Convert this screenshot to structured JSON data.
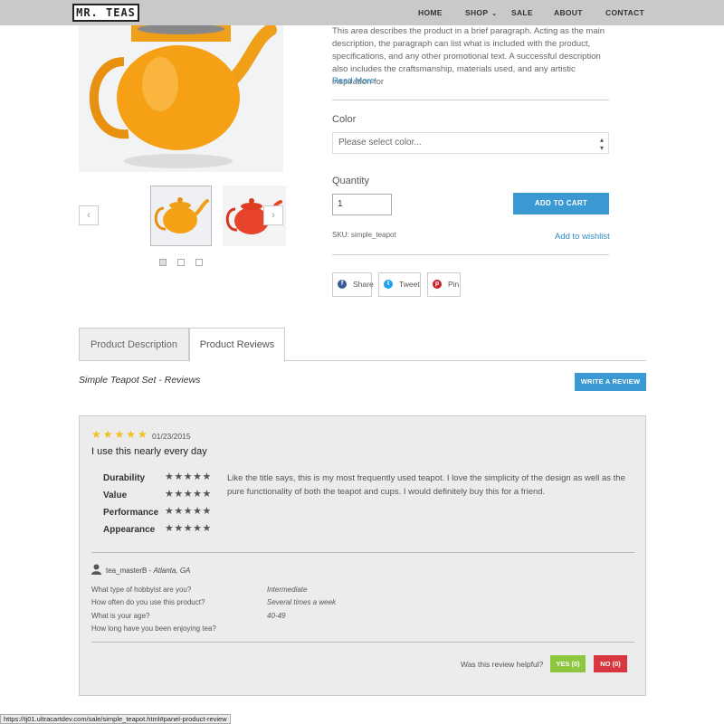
{
  "header": {
    "logo": "MR. TEAS",
    "nav": [
      {
        "label": "HOME"
      },
      {
        "label": "SHOP"
      },
      {
        "label": "SALE"
      },
      {
        "label": "ABOUT"
      },
      {
        "label": "CONTACT"
      }
    ]
  },
  "product": {
    "description": "This area describes the product in a brief paragraph. Acting as the main description, the paragraph can list what is included with the product, specifications, and any other promotional text. A successful description also includes the craftsmanship, materials used, and any artistic inspiration for",
    "read_more": "Read More",
    "color_label": "Color",
    "color_placeholder": "Please select color...",
    "quantity_label": "Quantity",
    "quantity_value": "1",
    "add_to_cart": "ADD TO CART",
    "sku": "SKU: simple_teapot",
    "wishlist": "Add to wishlist",
    "share": [
      {
        "label": "Share",
        "icon": "facebook-icon",
        "color": "#3b5998"
      },
      {
        "label": "Tweet",
        "icon": "twitter-icon",
        "color": "#1da1f2"
      },
      {
        "label": "Pin",
        "icon": "pinterest-icon",
        "color": "#cb2027"
      }
    ],
    "gallery_arrows": {
      "prev": "‹",
      "next": "›"
    },
    "image_colors": {
      "orange": "#f5a015",
      "red": "#e8442a"
    }
  },
  "tabs": [
    {
      "label": "Product Description",
      "active": false
    },
    {
      "label": "Product Reviews",
      "active": true
    }
  ],
  "reviews": {
    "title": "Simple Teapot Set - Reviews",
    "write_button": "WRITE A REVIEW",
    "items": [
      {
        "stars": "★★★★★",
        "date": "01/23/2015",
        "headline": "I use this nearly every day",
        "ratings": [
          {
            "label": "Durability",
            "stars": "★★★★★"
          },
          {
            "label": "Value",
            "stars": "★★★★★"
          },
          {
            "label": "Performance",
            "stars": "★★★★★"
          },
          {
            "label": "Appearance",
            "stars": "★★★★★"
          }
        ],
        "body": "Like the title says, this is my most frequently used teapot. I love the simplicity of the design as well as the pure functionality of both the teapot and cups. I would definitely buy this for a friend.",
        "reviewer": "tea_masterB",
        "location": "Atlanta, GA",
        "questions": [
          {
            "q": "What type of hobbyist are you?",
            "a": "Intermediate"
          },
          {
            "q": "How often do you use this product?",
            "a": "Several times a week"
          },
          {
            "q": "What is your age?",
            "a": "40-49"
          },
          {
            "q": "How long have you been enjoying tea?",
            "a": ""
          }
        ],
        "helpful_prompt": "Was this review helpful?",
        "yes_label": "YES (0)",
        "no_label": "NO (0)"
      }
    ]
  },
  "status_bar": {
    "url": "https://tj01.ultracartdev.com/sale/simple_teapot.html#panel-product-review"
  }
}
